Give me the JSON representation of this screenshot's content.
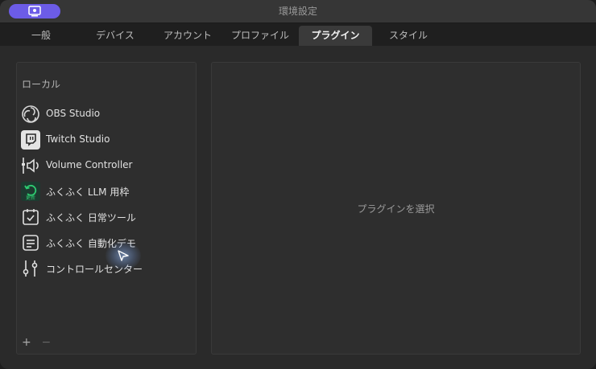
{
  "window": {
    "title": "環境設定"
  },
  "tabs": [
    {
      "label": "一般"
    },
    {
      "label": "デバイス"
    },
    {
      "label": "アカウント"
    },
    {
      "label": "プロファイル"
    },
    {
      "label": "プラグイン",
      "active": true
    },
    {
      "label": "スタイル"
    }
  ],
  "sidebar": {
    "section_label": "ローカル",
    "items": [
      {
        "label": "OBS Studio",
        "icon": "obs-icon"
      },
      {
        "label": "Twitch Studio",
        "icon": "twitch-icon"
      },
      {
        "label": "Volume Controller",
        "icon": "volume-controller-icon"
      },
      {
        "label": "ふくふく LLM 用枠",
        "icon": "update-icon"
      },
      {
        "label": "ふくふく 日常ツール",
        "icon": "calendar-check-icon"
      },
      {
        "label": "ふくふく 自動化デモ",
        "icon": "document-icon"
      },
      {
        "label": "コントロールセンター",
        "icon": "sliders-icon"
      }
    ],
    "add_label": "+",
    "remove_label": "−"
  },
  "detail": {
    "placeholder": "プラグインを選択"
  },
  "colors": {
    "accent": "#6c5ce7",
    "update_green": "#2ecc71"
  }
}
